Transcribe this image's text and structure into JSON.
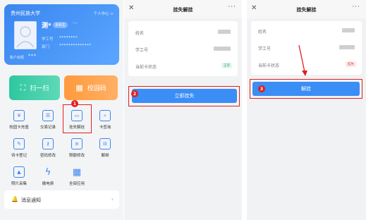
{
  "panel1": {
    "card": {
      "university": "贵州民族大学",
      "user_center": "个人中心 >",
      "name": "测*",
      "tag": "本科生",
      "more": "···",
      "student_id_label": "学工号",
      "student_id_value": "********",
      "dept_label": "部门",
      "dept_value": "**************",
      "balance_label": "账户余额",
      "balance_value": "***"
    },
    "quick": {
      "scan": "扫一扫",
      "code": "校园码"
    },
    "grid": [
      {
        "label": "校园卡充值",
        "icon": "recharge-icon",
        "glyph": "¥"
      },
      {
        "label": "交易记录",
        "icon": "transaction-icon",
        "glyph": "☰"
      },
      {
        "label": "挂失解挂",
        "icon": "lost-card-icon",
        "glyph": "▭"
      },
      {
        "label": "卡查询",
        "icon": "card-query-icon",
        "glyph": "⌕"
      },
      {
        "label": "待卡登记",
        "icon": "register-icon",
        "glyph": "✎"
      },
      {
        "label": "密码修改",
        "icon": "password-icon",
        "glyph": "⚷"
      },
      {
        "label": "限额修改",
        "icon": "limit-icon",
        "glyph": "≡"
      },
      {
        "label": "解绑",
        "icon": "unbind-icon",
        "glyph": "⊟"
      },
      {
        "label": "照片采集",
        "icon": "photo-icon",
        "glyph": "▲"
      },
      {
        "label": "缴电费",
        "icon": "electricity-icon",
        "glyph": "ϟ"
      },
      {
        "label": "全部应用",
        "icon": "all-apps-icon",
        "glyph": "▦"
      }
    ],
    "message": "消息通知",
    "step": "1"
  },
  "panel2": {
    "title": "挂失解挂",
    "name_label": "姓名",
    "id_label": "学工号",
    "status_label": "当前卡状态",
    "status_value": "正常",
    "button": "立即挂失",
    "step": "2"
  },
  "panel3": {
    "title": "挂失解挂",
    "name_label": "姓名",
    "id_label": "学工号",
    "status_label": "当前卡状态",
    "status_value": "挂失",
    "button": "解挂",
    "step": "3"
  },
  "colors": {
    "accent": "#3a86f0",
    "highlight": "#e02020",
    "green": "#2ec7a0",
    "orange": "#ff9a3c"
  }
}
